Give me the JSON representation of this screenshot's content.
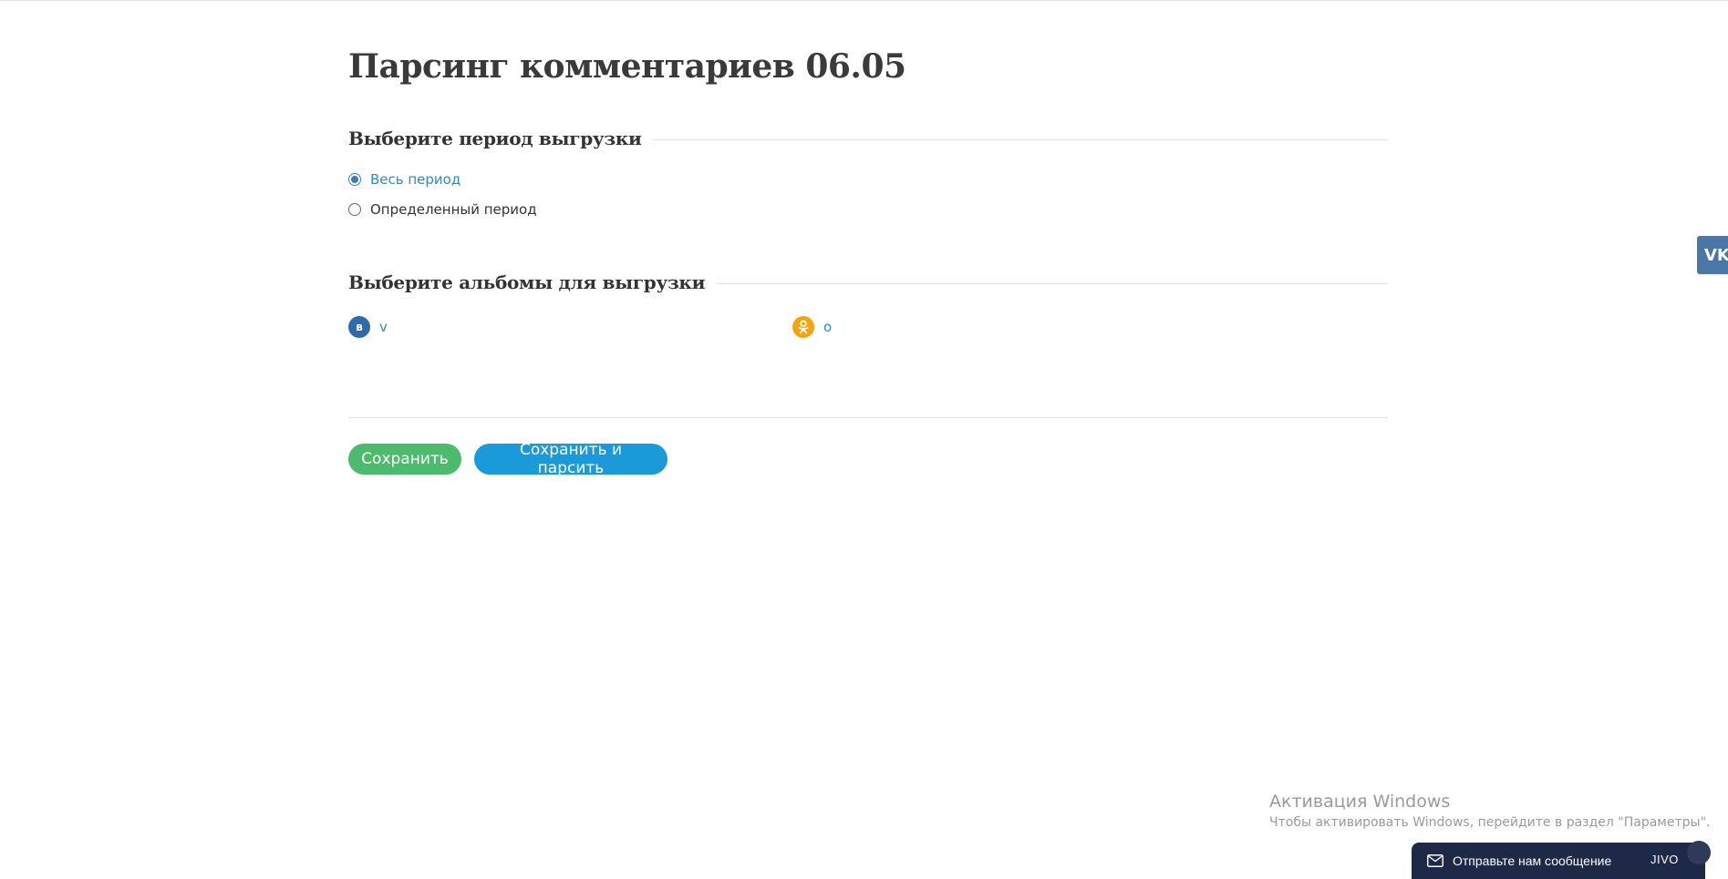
{
  "page": {
    "title": "Парсинг комментариев 06.05"
  },
  "period_section": {
    "title": "Выберите период выгрузки",
    "options": [
      {
        "label": "Весь период",
        "selected": true
      },
      {
        "label": "Определенный период",
        "selected": false
      }
    ]
  },
  "albums_section": {
    "title": "Выберите альбомы для выгрузки",
    "albums": [
      {
        "badge": "в",
        "label": "v",
        "network": "vk",
        "color": "#2d6bab"
      },
      {
        "badge": "ok",
        "label": "o",
        "network": "odnoklassniki",
        "color": "#f5a40d"
      }
    ]
  },
  "actions": {
    "save_label": "Сохранить",
    "save_parse_label": "Сохранить и парсить",
    "save_color": "#4cbb6e",
    "save_parse_color": "#1a9ad8"
  },
  "side_widget": {
    "icon": "vk-logo-icon",
    "text": "VK"
  },
  "windows_activation": {
    "title": "Активация Windows",
    "subtitle": "Чтобы активировать Windows, перейдите в раздел \"Параметры\"."
  },
  "chat_widget": {
    "message": "Отправьте нам сообщение",
    "brand": "JIVO",
    "icon": "envelope-icon",
    "background": "#1d2947"
  }
}
